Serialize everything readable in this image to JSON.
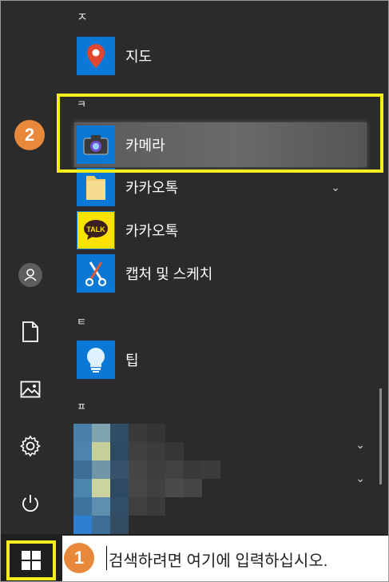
{
  "sections": [
    {
      "header": "ㅈ",
      "apps": [
        {
          "label": "지도",
          "icon": "map-pin-icon",
          "tile_color": "#0a78d4"
        }
      ]
    },
    {
      "header": "ㅋ",
      "apps": [
        {
          "label": "카메라",
          "icon": "camera-icon",
          "tile_color": "#0a78d4",
          "selected": true
        },
        {
          "label": "카카오톡",
          "icon": "folder-icon",
          "tile_color": "#0a78d4",
          "expandable": true
        },
        {
          "label": "카카오톡",
          "icon": "kakaotalk-icon",
          "tile_color": "#0a78d4",
          "icon_text": "TALK"
        },
        {
          "label": "캡처 및 스케치",
          "icon": "snip-sketch-icon",
          "tile_color": "#0a78d4"
        }
      ]
    },
    {
      "header": "ㅌ",
      "apps": [
        {
          "label": "팁",
          "icon": "lightbulb-icon",
          "tile_color": "#0a78d4"
        }
      ]
    },
    {
      "header": "ㅍ",
      "apps": []
    }
  ],
  "rail": [
    "user-icon",
    "document-icon",
    "pictures-icon",
    "settings-icon",
    "power-icon"
  ],
  "search": {
    "placeholder": "검색하려면 여기에 입력하십시오."
  },
  "annotations": {
    "step1": "1",
    "step2": "2"
  },
  "colors": {
    "highlight": "#f5ee1a",
    "badge": "#e8883a",
    "accent": "#0a78d4",
    "background": "#2b2b2b"
  }
}
